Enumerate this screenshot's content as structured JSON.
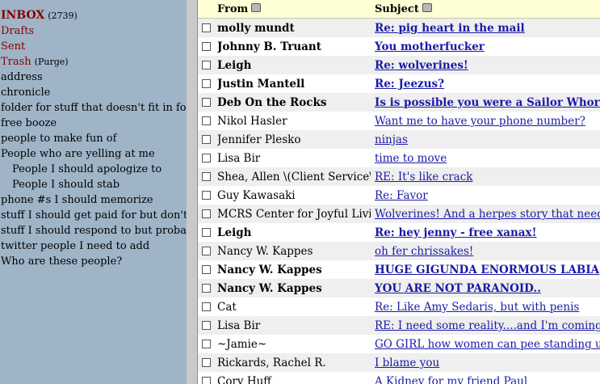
{
  "sidebar": {
    "folders": [
      {
        "label": "INBOX",
        "count": "(2739)",
        "kind": "inbox"
      },
      {
        "label": "Drafts",
        "kind": "sys"
      },
      {
        "label": "Sent",
        "kind": "sys"
      },
      {
        "label": "Trash",
        "count": "(Purge)",
        "kind": "sys"
      },
      {
        "label": "address"
      },
      {
        "label": "chronicle"
      },
      {
        "label": "folder for stuff that doesn't fit in folders"
      },
      {
        "label": "free booze"
      },
      {
        "label": "people to make fun of"
      },
      {
        "label": "People who are yelling at me"
      },
      {
        "label": "People I should apologize to",
        "indent": true
      },
      {
        "label": "People I should stab",
        "indent": true
      },
      {
        "label": "phone #s I should memorize"
      },
      {
        "label": "stuff I should get paid for but don't"
      },
      {
        "label": "stuff I should respond to but probably"
      },
      {
        "label": "twitter people I need to add"
      },
      {
        "label": "Who are these people?"
      }
    ]
  },
  "message_list": {
    "columns": {
      "from": "From",
      "subject": "Subject"
    },
    "messages": [
      {
        "from": "molly mundt",
        "subject": "Re: pig heart in the mail",
        "unread": true
      },
      {
        "from": "Johnny B. Truant",
        "subject": "You motherfucker",
        "unread": true
      },
      {
        "from": "Leigh",
        "subject": "Re: wolverines!",
        "unread": true
      },
      {
        "from": "Justin Mantell",
        "subject": "Re: Jeezus?",
        "unread": true
      },
      {
        "from": "Deb On the Rocks",
        "subject": "Is is possible you were a Sailor Whore in a",
        "unread": true
      },
      {
        "from": "Nikol Hasler",
        "subject": "Want me to have your phone number?",
        "unread": false
      },
      {
        "from": "Jennifer Plesko",
        "subject": "ninjas",
        "unread": false
      },
      {
        "from": "Lisa Bir",
        "subject": "time to move",
        "unread": false
      },
      {
        "from": "Shea, Allen \\(Client Service\\)",
        "subject": "RE: It's like crack",
        "unread": false
      },
      {
        "from": "Guy Kawasaki",
        "subject": "Re: Favor",
        "unread": false
      },
      {
        "from": "MCRS Center for Joyful Living",
        "subject": "Wolverines! And a herpes story that needs to c",
        "unread": false
      },
      {
        "from": "Leigh",
        "subject": "Re: hey jenny - free xanax!",
        "unread": true
      },
      {
        "from": "Nancy W. Kappes",
        "subject": "oh fer chrissakes!",
        "unread": false
      },
      {
        "from": "Nancy W. Kappes",
        "subject": "HUGE GIGUNDA ENORMOUS LABIA",
        "unread": true
      },
      {
        "from": "Nancy W. Kappes",
        "subject": "YOU ARE NOT PARANOID..",
        "unread": true
      },
      {
        "from": "Cat",
        "subject": "Re: Like Amy Sedaris, but with penis",
        "unread": false
      },
      {
        "from": "Lisa Bir",
        "subject": "RE: I need some reality....and I'm coming to yo",
        "unread": false
      },
      {
        "from": "~Jamie~",
        "subject": "GO GIRL how women can pee standing up.. G",
        "unread": false
      },
      {
        "from": "Rickards, Rachel R.",
        "subject": "I blame you",
        "unread": false
      },
      {
        "from": "Cory Huff",
        "subject": "A Kidney for my friend Paul",
        "unread": false
      }
    ]
  }
}
